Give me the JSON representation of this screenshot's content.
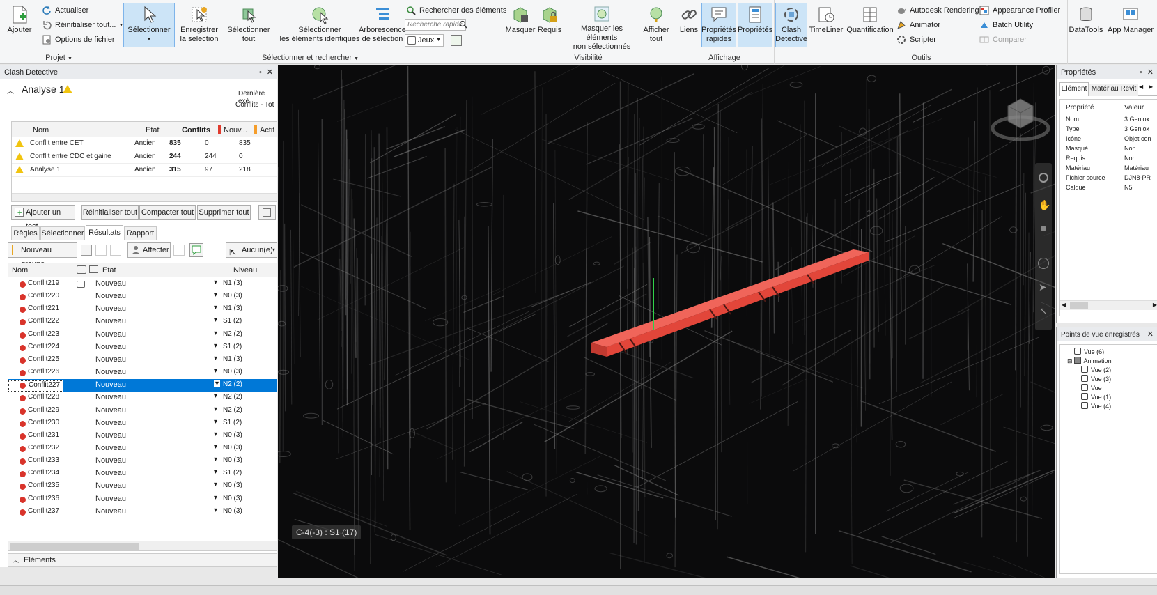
{
  "ribbon": {
    "projet": {
      "title": "Projet",
      "ajouter": "Ajouter",
      "actualiser": "Actualiser",
      "reinitialiser": "Réinitialiser tout...",
      "options": "Options de fichier"
    },
    "selection": {
      "title": "Sélectionner et rechercher",
      "selectionner": "Sélectionner",
      "enregistrer": "Enregistrer\nla sélection",
      "selectionner_tout": "Sélectionner\ntout",
      "identiques": "Sélectionner\nles éléments identiques",
      "arborescence": "Arborescence\nde sélection",
      "rechercher": "Rechercher des éléments",
      "recherche_placeholder": "Recherche rapide",
      "jeux": "Jeux"
    },
    "visibilite": {
      "title": "Visibilité",
      "masquer": "Masquer",
      "requis": "Requis",
      "masquer_non": "Masquer les éléments\nnon sélectionnés",
      "afficher_tout": "Afficher\ntout"
    },
    "affichage": {
      "title": "Affichage",
      "liens": "Liens",
      "proprietes_rapides": "Propriétés\nrapides",
      "proprietes": "Propriétés"
    },
    "outils": {
      "title": "Outils",
      "clash": "Clash\nDetective",
      "timeliner": "TimeLiner",
      "quantification": "Quantification",
      "autodesk_rendering": "Autodesk Rendering",
      "animator": "Animator",
      "scripter": "Scripter",
      "appearance": "Appearance Profiler",
      "batch": "Batch Utility",
      "comparer": "Comparer",
      "datatools": "DataTools",
      "app_manager": "App Manager"
    }
  },
  "clash_panel": {
    "title": "Clash Detective",
    "test_name": "Analyse 1",
    "last_exec": "Dernière exé",
    "conflicts_summary": "Conflits - Tot",
    "tests_headers": [
      "Nom",
      "Etat",
      "Conflits",
      "Nouv...",
      "Actif"
    ],
    "tests": [
      {
        "name": "Conflit entre CET",
        "etat": "Ancien",
        "conflits": "835",
        "nouveau": "0",
        "actif": "835"
      },
      {
        "name": "Conflit entre CDC et gaine",
        "etat": "Ancien",
        "conflits": "244",
        "nouveau": "244",
        "actif": "0"
      },
      {
        "name": "Analyse 1",
        "etat": "Ancien",
        "conflits": "315",
        "nouveau": "97",
        "actif": "218"
      }
    ],
    "buttons": {
      "ajouter_test": "Ajouter un test",
      "reinitialiser_tout": "Réinitialiser tout",
      "compacter_tout": "Compacter tout",
      "supprimer_tout": "Supprimer tout"
    },
    "tabs": [
      "Règles",
      "Sélectionner",
      "Résultats",
      "Rapport"
    ],
    "active_tab": "Résultats",
    "results_toolbar": {
      "nouveau_groupe": "Nouveau groupe",
      "affecter": "Affecter",
      "aucun": "Aucun(e)"
    },
    "results_headers": [
      "Nom",
      "Etat",
      "Niveau"
    ],
    "results": [
      {
        "name": "Conflit219",
        "etat": "Nouveau",
        "niveau": "N1 (3)"
      },
      {
        "name": "Conflit220",
        "etat": "Nouveau",
        "niveau": "N0 (3)"
      },
      {
        "name": "Conflit221",
        "etat": "Nouveau",
        "niveau": "N1 (3)"
      },
      {
        "name": "Conflit222",
        "etat": "Nouveau",
        "niveau": "S1 (2)"
      },
      {
        "name": "Conflit223",
        "etat": "Nouveau",
        "niveau": "N2 (2)"
      },
      {
        "name": "Conflit224",
        "etat": "Nouveau",
        "niveau": "S1 (2)"
      },
      {
        "name": "Conflit225",
        "etat": "Nouveau",
        "niveau": "N1 (3)"
      },
      {
        "name": "Conflit226",
        "etat": "Nouveau",
        "niveau": "N0 (3)"
      },
      {
        "name": "Conflit227",
        "etat": "Nouveau",
        "niveau": "N2 (2)"
      },
      {
        "name": "Conflit228",
        "etat": "Nouveau",
        "niveau": "N2 (2)"
      },
      {
        "name": "Conflit229",
        "etat": "Nouveau",
        "niveau": "N2 (2)"
      },
      {
        "name": "Conflit230",
        "etat": "Nouveau",
        "niveau": "S1 (2)"
      },
      {
        "name": "Conflit231",
        "etat": "Nouveau",
        "niveau": "N0 (3)"
      },
      {
        "name": "Conflit232",
        "etat": "Nouveau",
        "niveau": "N0 (3)"
      },
      {
        "name": "Conflit233",
        "etat": "Nouveau",
        "niveau": "N0 (3)"
      },
      {
        "name": "Conflit234",
        "etat": "Nouveau",
        "niveau": "S1 (2)"
      },
      {
        "name": "Conflit235",
        "etat": "Nouveau",
        "niveau": "N0 (3)"
      },
      {
        "name": "Conflit236",
        "etat": "Nouveau",
        "niveau": "N0 (3)"
      },
      {
        "name": "Conflit237",
        "etat": "Nouveau",
        "niveau": "N0 (3)"
      }
    ],
    "selected_result": "Conflit227",
    "elements_label": "Eléments"
  },
  "viewport": {
    "location_label": "C-4(-3) : S1 (17)"
  },
  "properties_panel": {
    "title": "Propriétés",
    "tabs": [
      "Elément",
      "Matériau Revit"
    ],
    "headers": [
      "Propriété",
      "Valeur"
    ],
    "rows": [
      {
        "prop": "Nom",
        "val": "3 Geniox"
      },
      {
        "prop": "Type",
        "val": "3 Geniox"
      },
      {
        "prop": "Icône",
        "val": "Objet con"
      },
      {
        "prop": "Masqué",
        "val": "Non"
      },
      {
        "prop": "Requis",
        "val": "Non"
      },
      {
        "prop": "Matériau",
        "val": "Matériau"
      },
      {
        "prop": "Fichier source",
        "val": "DJN8-PR"
      },
      {
        "prop": "Calque",
        "val": "N5"
      }
    ]
  },
  "views_panel": {
    "title": "Points de vue enregistrés",
    "items": [
      "Vue (6)",
      "Animation",
      "Vue (2)",
      "Vue (3)",
      "Vue",
      "Vue (1)",
      "Vue (4)"
    ]
  },
  "colors": {
    "accent": "#0078d7",
    "clash_red": "#e8443a",
    "warning": "#f1c40f",
    "active_ribbon": "#cce4f7"
  }
}
